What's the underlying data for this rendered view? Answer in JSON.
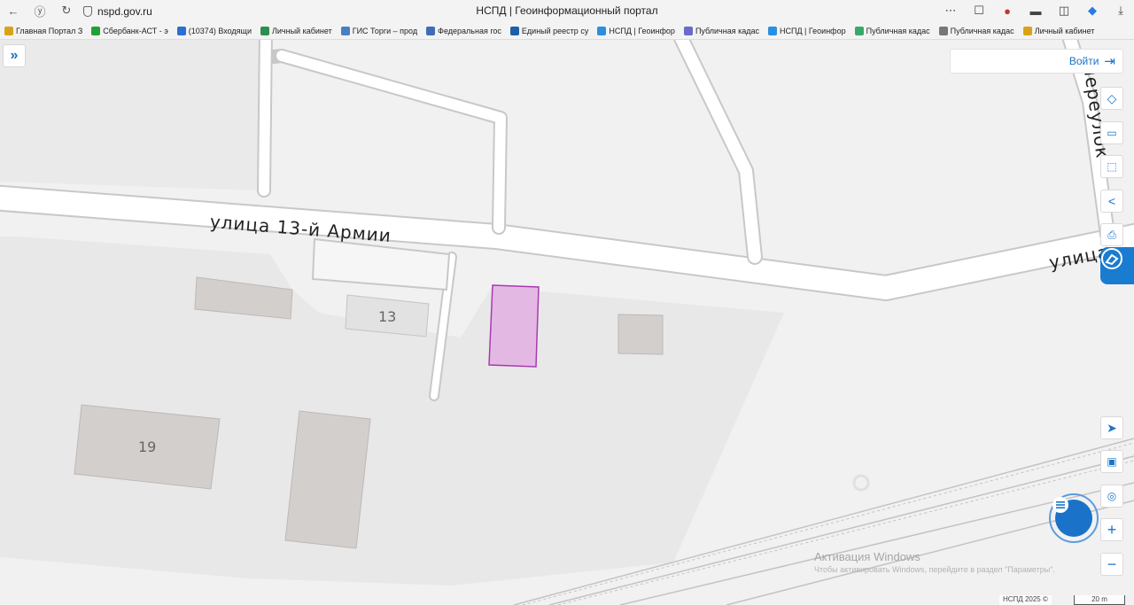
{
  "browser": {
    "url": "nspd.gov.ru",
    "title": "НСПД | Геоинформационный портал"
  },
  "bookmarks": [
    {
      "label": "Главная Портал З",
      "color": "#d9a21b"
    },
    {
      "label": "Сбербанк-АСТ - э",
      "color": "#21a038"
    },
    {
      "label": "(10374) Входящи",
      "color": "#2b6fd6"
    },
    {
      "label": "Личный кабинет",
      "color": "#2d8f4e"
    },
    {
      "label": "ГИС Торги – прод",
      "color": "#4a7fc1"
    },
    {
      "label": "Федеральная гос",
      "color": "#3f6db5"
    },
    {
      "label": "Единый реестр су",
      "color": "#1c5ea8"
    },
    {
      "label": "НСПД | Геоинфор",
      "color": "#2a8fe0"
    },
    {
      "label": "Публичная кадас",
      "color": "#6a6ac9"
    },
    {
      "label": "НСПД | Геоинфор",
      "color": "#2a8fe0"
    },
    {
      "label": "Публичная кадас",
      "color": "#3aa86b"
    },
    {
      "label": "Публичная кадас",
      "color": "#777777"
    },
    {
      "label": "Личный кабинет",
      "color": "#d9a21b"
    }
  ],
  "map": {
    "street_main": "улица 13-й Армии",
    "street_right": "улица",
    "street_lane": "переулок",
    "buildings": [
      "13",
      "19"
    ],
    "highlight_color": "#e3b9e3",
    "highlight_border": "#a83ab3"
  },
  "controls": {
    "login_label": "Войти",
    "copyright": "НСПД 2025 ©",
    "scale": "20 m"
  },
  "watermark": {
    "title": "Активация Windows",
    "subtitle": "Чтобы активировать Windows, перейдите в раздел \"Параметры\"."
  }
}
